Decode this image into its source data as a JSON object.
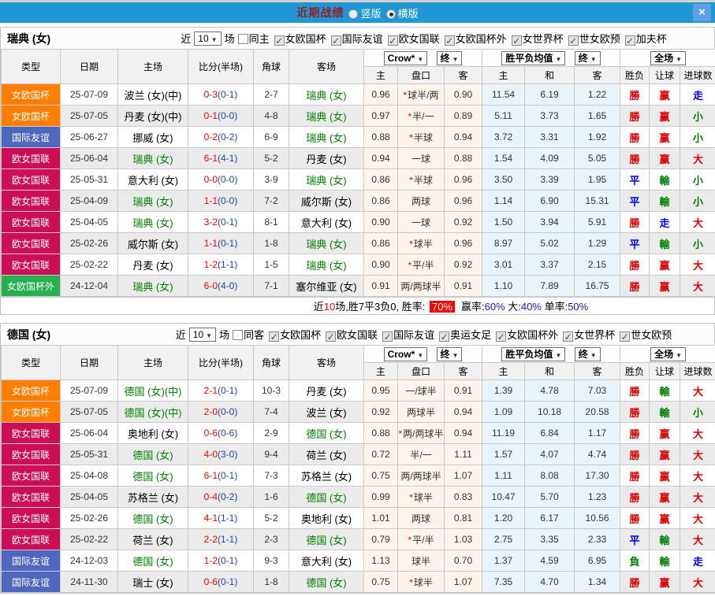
{
  "titlebar": {
    "title": "近期战绩",
    "option_vertical": "竖版",
    "option_horizontal": "横版",
    "close_label": "×"
  },
  "colors": {
    "topbar_bg": "#1E97D4",
    "badge_orange": "#FF7E00",
    "badge_blue": "#4D68BE",
    "badge_crimson": "#CB0E56",
    "badge_green": "#27AE4E",
    "score_red": "#FF0000",
    "half_blue": "#2244BB",
    "team_green": "#008000",
    "win_red": "#E00000",
    "draw_blue": "#0000F0",
    "lose_green": "#008000",
    "handicap_cols_bg": "#FDF5EB",
    "avg_cols_bg": "#E8F3FA"
  },
  "table_header": {
    "type": "类型",
    "date": "日期",
    "home": "主场",
    "score_half": "比分(半场)",
    "corner": "角球",
    "away": "客场",
    "bookmaker_select": "Crow*",
    "final_select": "终",
    "avg_select": "胜平负均值",
    "final_avg_select": "终",
    "fullmatch_select": "全场",
    "sub_home": "主",
    "sub_handicap": "盘口",
    "sub_away": "客",
    "sub_avg_home": "主",
    "sub_avg_draw": "和",
    "sub_avg_away": "客",
    "winloss": "胜负",
    "handicap_result": "让球",
    "goals": "进球数"
  },
  "sections": [
    {
      "team": "瑞典 (女)",
      "filter": {
        "near_label": "近",
        "count": "10",
        "matches_label": "场",
        "same_side_label": "同主",
        "same_side_checked": false,
        "competitions": [
          "女欧国杯",
          "国际友谊",
          "欧女国联",
          "女欧国杯外",
          "女世界杯",
          "世女欧预",
          "加夫杯"
        ]
      },
      "rows": [
        {
          "type": "女欧国杯",
          "type_color": "#FF7E00",
          "date": "25-07-09",
          "home": "波兰 (女)(中)",
          "home_highlight": false,
          "score": "0-3",
          "half_score": "(0-1)",
          "corner": "2-7",
          "away": "瑞典 (女)",
          "away_highlight": true,
          "odds_home": "0.96",
          "handicap_star": true,
          "handicap": "球半/两",
          "odds_away": "0.90",
          "avg_home": "11.54",
          "avg_draw": "6.19",
          "avg_away": "1.22",
          "result": "勝",
          "result_color": "red",
          "handicap_result": "赢",
          "handicap_result_color": "red",
          "goals_result": "走",
          "goals_result_color": "blue"
        },
        {
          "type": "女欧国杯",
          "type_color": "#FF7E00",
          "date": "25-07-05",
          "home": "丹麦 (女)(中)",
          "home_highlight": false,
          "score": "0-1",
          "half_score": "(0-0)",
          "corner": "4-8",
          "away": "瑞典 (女)",
          "away_highlight": true,
          "odds_home": "0.97",
          "handicap_star": true,
          "handicap": "半/一",
          "odds_away": "0.89",
          "avg_home": "5.11",
          "avg_draw": "3.73",
          "avg_away": "1.65",
          "result": "勝",
          "result_color": "red",
          "handicap_result": "赢",
          "handicap_result_color": "red",
          "goals_result": "小",
          "goals_result_color": "green"
        },
        {
          "type": "国际友谊",
          "type_color": "#4D68BE",
          "date": "25-06-27",
          "home": "挪威 (女)",
          "home_highlight": false,
          "score": "0-2",
          "half_score": "(0-2)",
          "corner": "6-9",
          "away": "瑞典 (女)",
          "away_highlight": true,
          "odds_home": "0.88",
          "handicap_star": true,
          "handicap": "半球",
          "odds_away": "0.94",
          "avg_home": "3.72",
          "avg_draw": "3.31",
          "avg_away": "1.92",
          "result": "勝",
          "result_color": "red",
          "handicap_result": "赢",
          "handicap_result_color": "red",
          "goals_result": "小",
          "goals_result_color": "green"
        },
        {
          "type": "欧女国联",
          "type_color": "#CB0E56",
          "date": "25-06-04",
          "home": "瑞典 (女)",
          "home_highlight": true,
          "score": "6-1",
          "half_score": "(4-1)",
          "corner": "5-2",
          "away": "丹麦 (女)",
          "away_highlight": false,
          "odds_home": "0.94",
          "handicap_star": false,
          "handicap": "一球",
          "odds_away": "0.88",
          "avg_home": "1.54",
          "avg_draw": "4.09",
          "avg_away": "5.05",
          "result": "勝",
          "result_color": "red",
          "handicap_result": "赢",
          "handicap_result_color": "red",
          "goals_result": "大",
          "goals_result_color": "red"
        },
        {
          "type": "欧女国联",
          "type_color": "#CB0E56",
          "date": "25-05-31",
          "home": "意大利 (女)",
          "home_highlight": false,
          "score": "0-0",
          "half_score": "(0-0)",
          "corner": "3-9",
          "away": "瑞典 (女)",
          "away_highlight": true,
          "odds_home": "0.86",
          "handicap_star": true,
          "handicap": "半球",
          "odds_away": "0.96",
          "avg_home": "3.50",
          "avg_draw": "3.39",
          "avg_away": "1.95",
          "result": "平",
          "result_color": "blue",
          "handicap_result": "輸",
          "handicap_result_color": "green",
          "goals_result": "小",
          "goals_result_color": "green"
        },
        {
          "type": "欧女国联",
          "type_color": "#CB0E56",
          "date": "25-04-09",
          "home": "瑞典 (女)",
          "home_highlight": true,
          "score": "1-1",
          "half_score": "(0-0)",
          "corner": "7-2",
          "away": "威尔斯 (女)",
          "away_highlight": false,
          "odds_home": "0.86",
          "handicap_star": false,
          "handicap": "两球",
          "odds_away": "0.96",
          "avg_home": "1.14",
          "avg_draw": "6.90",
          "avg_away": "15.31",
          "result": "平",
          "result_color": "blue",
          "handicap_result": "輸",
          "handicap_result_color": "green",
          "goals_result": "小",
          "goals_result_color": "green"
        },
        {
          "type": "欧女国联",
          "type_color": "#CB0E56",
          "date": "25-04-05",
          "home": "瑞典 (女)",
          "home_highlight": true,
          "score": "3-2",
          "half_score": "(0-1)",
          "corner": "8-1",
          "away": "意大利 (女)",
          "away_highlight": false,
          "odds_home": "0.90",
          "handicap_star": false,
          "handicap": "一球",
          "odds_away": "0.92",
          "avg_home": "1.50",
          "avg_draw": "3.94",
          "avg_away": "5.91",
          "result": "勝",
          "result_color": "red",
          "handicap_result": "走",
          "handicap_result_color": "blue",
          "goals_result": "大",
          "goals_result_color": "red"
        },
        {
          "type": "欧女国联",
          "type_color": "#CB0E56",
          "date": "25-02-26",
          "home": "威尔斯 (女)",
          "home_highlight": false,
          "score": "1-1",
          "half_score": "(0-1)",
          "corner": "1-8",
          "away": "瑞典 (女)",
          "away_highlight": true,
          "odds_home": "0.86",
          "handicap_star": true,
          "handicap": "球半",
          "odds_away": "0.96",
          "avg_home": "8.97",
          "avg_draw": "5.02",
          "avg_away": "1.29",
          "result": "平",
          "result_color": "blue",
          "handicap_result": "輸",
          "handicap_result_color": "green",
          "goals_result": "小",
          "goals_result_color": "green"
        },
        {
          "type": "欧女国联",
          "type_color": "#CB0E56",
          "date": "25-02-22",
          "home": "丹麦 (女)",
          "home_highlight": false,
          "score": "1-2",
          "half_score": "(1-1)",
          "corner": "1-5",
          "away": "瑞典 (女)",
          "away_highlight": true,
          "odds_home": "0.90",
          "handicap_star": true,
          "handicap": "平/半",
          "odds_away": "0.92",
          "avg_home": "3.01",
          "avg_draw": "3.37",
          "avg_away": "2.15",
          "result": "勝",
          "result_color": "red",
          "handicap_result": "赢",
          "handicap_result_color": "red",
          "goals_result": "大",
          "goals_result_color": "red"
        },
        {
          "type": "女欧国杯外",
          "type_color": "#27AE4E",
          "date": "24-12-04",
          "home": "瑞典 (女)",
          "home_highlight": true,
          "score": "6-0",
          "half_score": "(4-0)",
          "corner": "7-1",
          "away": "塞尔维亚 (女)",
          "away_highlight": false,
          "odds_home": "0.91",
          "handicap_star": false,
          "handicap": "两/两球半",
          "odds_away": "0.91",
          "avg_home": "1.10",
          "avg_draw": "7.89",
          "avg_away": "16.75",
          "result": "勝",
          "result_color": "red",
          "handicap_result": "赢",
          "handicap_result_color": "red",
          "goals_result": "大",
          "goals_result_color": "red"
        }
      ],
      "summary": {
        "prefix": "近",
        "count": "10",
        "stats": "场,胜7平3负0, 胜率:",
        "win_rate": "70%",
        "handicap_label": "赢率:",
        "handicap_rate": "60%",
        "big_label": "大:",
        "big_rate": "40%",
        "single_label": "单率:",
        "single_rate": "50%"
      }
    },
    {
      "team": "德国 (女)",
      "filter": {
        "near_label": "近",
        "count": "10",
        "matches_label": "场",
        "same_side_label": "同客",
        "same_side_checked": false,
        "competitions": [
          "女欧国杯",
          "欧女国联",
          "国际友谊",
          "奥运女足",
          "女欧国杯外",
          "女世界杯",
          "世女欧预"
        ]
      },
      "rows": [
        {
          "type": "女欧国杯",
          "type_color": "#FF7E00",
          "date": "25-07-09",
          "home": "德国 (女)(中)",
          "home_highlight": true,
          "score": "2-1",
          "half_score": "(0-1)",
          "corner": "10-3",
          "away": "丹麦 (女)",
          "away_highlight": false,
          "odds_home": "0.95",
          "handicap_star": false,
          "handicap": "一/球半",
          "odds_away": "0.91",
          "avg_home": "1.39",
          "avg_draw": "4.78",
          "avg_away": "7.03",
          "result": "勝",
          "result_color": "red",
          "handicap_result": "輸",
          "handicap_result_color": "green",
          "goals_result": "大",
          "goals_result_color": "red"
        },
        {
          "type": "女欧国杯",
          "type_color": "#FF7E00",
          "date": "25-07-05",
          "home": "德国 (女)(中)",
          "home_highlight": true,
          "score": "2-0",
          "half_score": "(0-0)",
          "corner": "7-4",
          "away": "波兰 (女)",
          "away_highlight": false,
          "odds_home": "0.92",
          "handicap_star": false,
          "handicap": "两球半",
          "odds_away": "0.94",
          "avg_home": "1.09",
          "avg_draw": "10.18",
          "avg_away": "20.58",
          "result": "勝",
          "result_color": "red",
          "handicap_result": "輸",
          "handicap_result_color": "green",
          "goals_result": "小",
          "goals_result_color": "green"
        },
        {
          "type": "欧女国联",
          "type_color": "#CB0E56",
          "date": "25-06-04",
          "home": "奥地利 (女)",
          "home_highlight": false,
          "score": "0-6",
          "half_score": "(0-6)",
          "corner": "2-9",
          "away": "德国 (女)",
          "away_highlight": true,
          "odds_home": "0.88",
          "handicap_star": true,
          "handicap": "两/两球半",
          "odds_away": "0.94",
          "avg_home": "11.19",
          "avg_draw": "6.84",
          "avg_away": "1.17",
          "result": "勝",
          "result_color": "red",
          "handicap_result": "赢",
          "handicap_result_color": "red",
          "goals_result": "大",
          "goals_result_color": "red"
        },
        {
          "type": "欧女国联",
          "type_color": "#CB0E56",
          "date": "25-05-31",
          "home": "德国 (女)",
          "home_highlight": true,
          "score": "4-0",
          "half_score": "(3-0)",
          "corner": "9-4",
          "away": "荷兰 (女)",
          "away_highlight": false,
          "odds_home": "0.72",
          "handicap_star": false,
          "handicap": "半/一",
          "odds_away": "1.11",
          "avg_home": "1.57",
          "avg_draw": "4.07",
          "avg_away": "4.74",
          "result": "勝",
          "result_color": "red",
          "handicap_result": "赢",
          "handicap_result_color": "red",
          "goals_result": "大",
          "goals_result_color": "red"
        },
        {
          "type": "欧女国联",
          "type_color": "#CB0E56",
          "date": "25-04-08",
          "home": "德国 (女)",
          "home_highlight": true,
          "score": "6-1",
          "half_score": "(0-1)",
          "corner": "7-3",
          "away": "苏格兰 (女)",
          "away_highlight": false,
          "odds_home": "0.75",
          "handicap_star": false,
          "handicap": "两/两球半",
          "odds_away": "1.07",
          "avg_home": "1.11",
          "avg_draw": "8.08",
          "avg_away": "17.30",
          "result": "勝",
          "result_color": "red",
          "handicap_result": "赢",
          "handicap_result_color": "red",
          "goals_result": "大",
          "goals_result_color": "red"
        },
        {
          "type": "欧女国联",
          "type_color": "#CB0E56",
          "date": "25-04-05",
          "home": "苏格兰 (女)",
          "home_highlight": false,
          "score": "0-4",
          "half_score": "(0-2)",
          "corner": "1-6",
          "away": "德国 (女)",
          "away_highlight": true,
          "odds_home": "0.99",
          "handicap_star": true,
          "handicap": "球半",
          "odds_away": "0.83",
          "avg_home": "10.47",
          "avg_draw": "5.70",
          "avg_away": "1.23",
          "result": "勝",
          "result_color": "red",
          "handicap_result": "赢",
          "handicap_result_color": "red",
          "goals_result": "大",
          "goals_result_color": "red"
        },
        {
          "type": "欧女国联",
          "type_color": "#CB0E56",
          "date": "25-02-26",
          "home": "德国 (女)",
          "home_highlight": true,
          "score": "4-1",
          "half_score": "(1-1)",
          "corner": "5-2",
          "away": "奥地利 (女)",
          "away_highlight": false,
          "odds_home": "1.01",
          "handicap_star": false,
          "handicap": "两球",
          "odds_away": "0.81",
          "avg_home": "1.20",
          "avg_draw": "6.17",
          "avg_away": "10.56",
          "result": "勝",
          "result_color": "red",
          "handicap_result": "赢",
          "handicap_result_color": "red",
          "goals_result": "大",
          "goals_result_color": "red"
        },
        {
          "type": "欧女国联",
          "type_color": "#CB0E56",
          "date": "25-02-22",
          "home": "荷兰 (女)",
          "home_highlight": false,
          "score": "2-2",
          "half_score": "(1-1)",
          "corner": "2-3",
          "away": "德国 (女)",
          "away_highlight": true,
          "odds_home": "0.79",
          "handicap_star": true,
          "handicap": "平/半",
          "odds_away": "1.03",
          "avg_home": "2.75",
          "avg_draw": "3.35",
          "avg_away": "2.33",
          "result": "平",
          "result_color": "blue",
          "handicap_result": "輸",
          "handicap_result_color": "green",
          "goals_result": "大",
          "goals_result_color": "red"
        },
        {
          "type": "国际友谊",
          "type_color": "#4D68BE",
          "date": "24-12-03",
          "home": "德国 (女)",
          "home_highlight": true,
          "score": "1-2",
          "half_score": "(0-1)",
          "corner": "9-3",
          "away": "意大利 (女)",
          "away_highlight": false,
          "odds_home": "1.13",
          "handicap_star": false,
          "handicap": "球半",
          "odds_away": "0.70",
          "avg_home": "1.37",
          "avg_draw": "4.59",
          "avg_away": "6.95",
          "result": "負",
          "result_color": "green",
          "handicap_result": "輸",
          "handicap_result_color": "green",
          "goals_result": "走",
          "goals_result_color": "blue"
        },
        {
          "type": "国际友谊",
          "type_color": "#4D68BE",
          "date": "24-11-30",
          "home": "瑞士 (女)",
          "home_highlight": false,
          "score": "0-6",
          "half_score": "(0-1)",
          "corner": "1-8",
          "away": "德国 (女)",
          "away_highlight": true,
          "odds_home": "0.75",
          "handicap_star": true,
          "handicap": "球半",
          "odds_away": "1.07",
          "avg_home": "7.35",
          "avg_draw": "4.70",
          "avg_away": "1.34",
          "result": "勝",
          "result_color": "red",
          "handicap_result": "赢",
          "handicap_result_color": "red",
          "goals_result": "大",
          "goals_result_color": "red"
        }
      ]
    }
  ]
}
